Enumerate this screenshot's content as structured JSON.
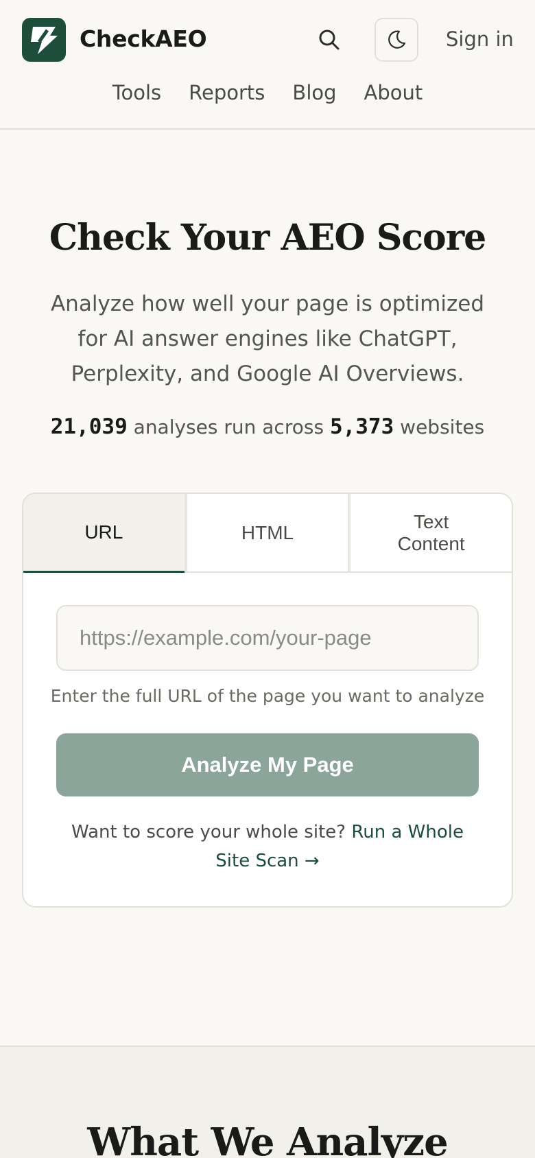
{
  "header": {
    "brand": "CheckAEO",
    "sign_in": "Sign in",
    "nav": [
      "Tools",
      "Reports",
      "Blog",
      "About"
    ],
    "icons": {
      "logo": "bolt-icon",
      "search": "search-icon",
      "theme": "moon-icon"
    }
  },
  "hero": {
    "title": "Check Your AEO Score",
    "subtitle": "Analyze how well your page is optimized for AI answer engines like ChatGPT, Perplexity, and Google AI Overviews.",
    "stats": {
      "analyses": "21,039",
      "analyses_text": "analyses run across",
      "websites": "5,373",
      "websites_text": "websites"
    }
  },
  "card": {
    "tabs": [
      "URL",
      "HTML",
      "Text Content"
    ],
    "active_tab": "URL",
    "input_placeholder": "https://example.com/your-page",
    "input_value": "",
    "hint": "Enter the full URL of the page you want to analyze",
    "analyze_button": "Analyze My Page",
    "whole_site_prefix": "Want to score your whole site?",
    "whole_site_link": "Run a Whole Site Scan →"
  },
  "section2": {
    "title": "What We Analyze"
  },
  "colors": {
    "brand": "#1f4d3c",
    "button_disabled": "#8ca59b",
    "background": "#f9f8f5"
  }
}
